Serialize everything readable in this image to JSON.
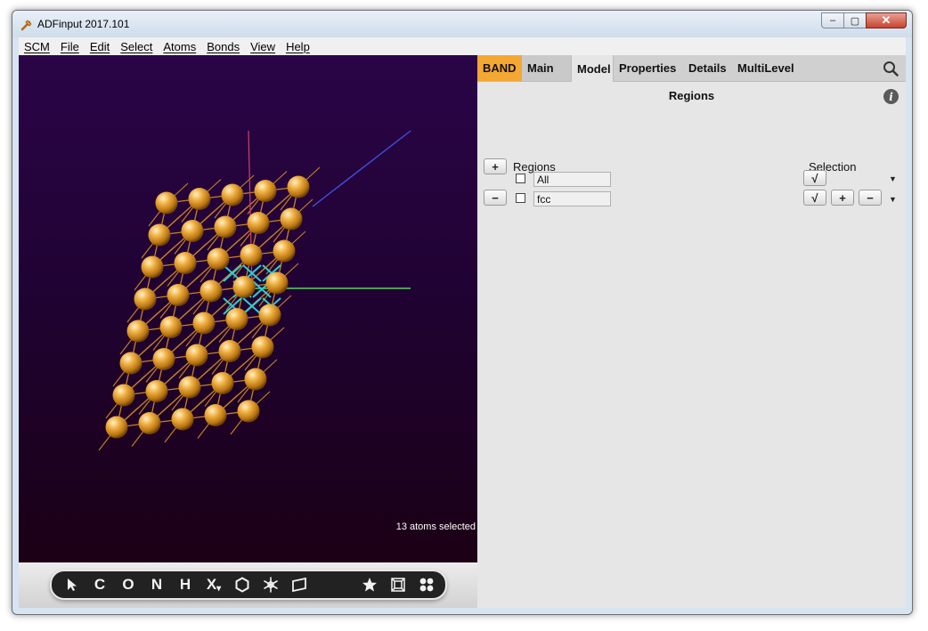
{
  "window": {
    "title": "ADFinput 2017.101",
    "minimize_glyph": "–",
    "maximize_glyph": "▢",
    "close_glyph": "✕"
  },
  "menu": {
    "items": [
      "SCM",
      "File",
      "Edit",
      "Select",
      "Atoms",
      "Bonds",
      "View",
      "Help"
    ]
  },
  "viewer": {
    "status": "13 atoms selected",
    "background_top": "#2a0547",
    "background_bottom": "#1a0010",
    "atom_color": "#e5a533",
    "bond_color": "#c8831f",
    "selection_color": "#2ad0d0"
  },
  "toolbar": {
    "letters": {
      "c": "C",
      "o": "O",
      "n": "N",
      "h": "H",
      "x": "X",
      "x_dropdown": "▾"
    },
    "icons": [
      "select-arrow-icon",
      "ring-icon",
      "snowflake-icon",
      "plane-icon",
      "star-icon",
      "box-icon",
      "atoms-cluster-icon"
    ]
  },
  "panel": {
    "tabs": {
      "band": "BAND",
      "main": "Main",
      "model": "Model",
      "properties": "Properties",
      "details": "Details",
      "multilevel": "MultiLevel"
    },
    "accent_color": "#f4a733",
    "title": "Regions",
    "info_glyph": "i",
    "regions_header": "Regions",
    "selection_header": "Selection",
    "add_glyph": "+",
    "remove_glyph": "−",
    "check_glyph": "√",
    "dropdown_glyph": "▼",
    "rows": [
      {
        "name": "All"
      },
      {
        "name": "fcc"
      }
    ]
  }
}
